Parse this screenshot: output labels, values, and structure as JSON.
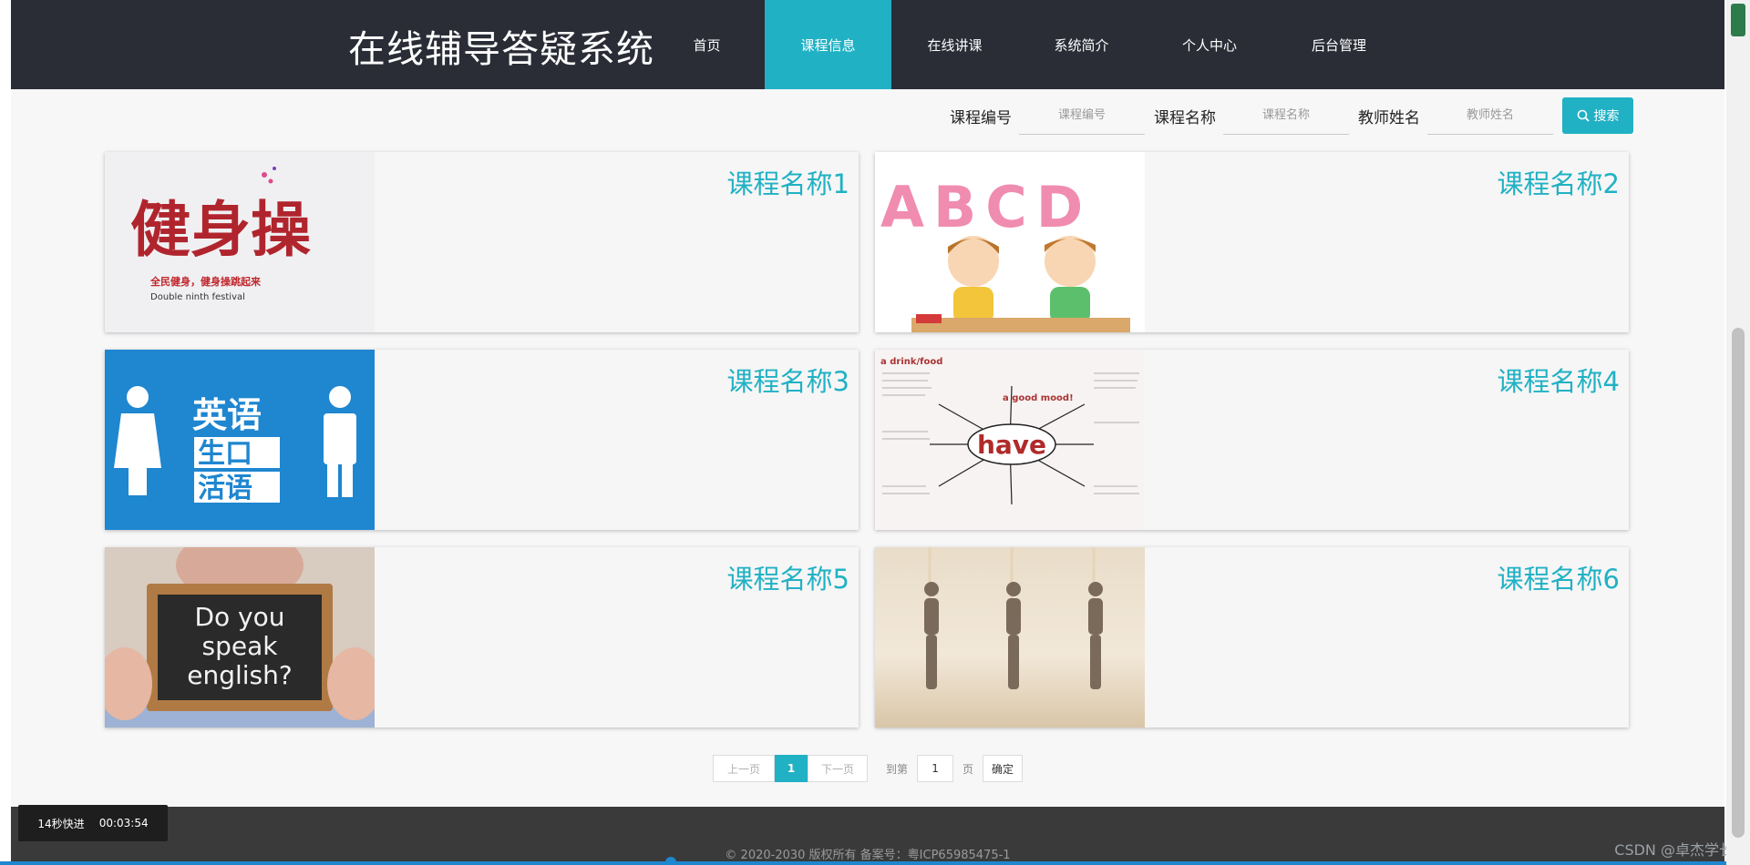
{
  "header": {
    "site_title": "在线辅导答疑系统",
    "nav": [
      {
        "label": "首页",
        "width": 127
      },
      {
        "label": "课程信息",
        "width": 139,
        "active": true
      },
      {
        "label": "在线讲课",
        "width": 139
      },
      {
        "label": "系统简介",
        "width": 139
      },
      {
        "label": "个人中心",
        "width": 142
      },
      {
        "label": "后台管理",
        "width": 142
      }
    ]
  },
  "search": {
    "course_code_label": "课程编号",
    "course_code_placeholder": "课程编号",
    "course_name_label": "课程名称",
    "course_name_placeholder": "课程名称",
    "teacher_label": "教师姓名",
    "teacher_placeholder": "教师姓名",
    "button_label": "搜索"
  },
  "courses": [
    {
      "title": "课程名称1",
      "thumb_text": "健身操",
      "thumb_sub": "全民健身，健身操跳起来",
      "thumb_sub2": "Double ninth festival"
    },
    {
      "title": "课程名称2",
      "thumb_text": "ABCD"
    },
    {
      "title": "课程名称3",
      "thumb_text": "英语",
      "thumb_sub": "生口",
      "thumb_sub2": "活语"
    },
    {
      "title": "课程名称4",
      "thumb_text": "have",
      "thumb_sub": "a drink/food",
      "thumb_sub2": "a good mood!"
    },
    {
      "title": "课程名称5",
      "thumb_text": "Do you",
      "thumb_sub": "speak",
      "thumb_sub2": "english?"
    },
    {
      "title": "课程名称6"
    }
  ],
  "pagination": {
    "prev_label": "上一页",
    "current_page": "1",
    "next_label": "下一页",
    "goto_label": "到第",
    "goto_value": "1",
    "page_unit": "页",
    "confirm_label": "确定"
  },
  "footer": {
    "copyright": "© 2020-2030 版权所有 备案号：粤ICP65985475-1"
  },
  "overlay": {
    "fast_forward": "14秒快进",
    "timestamp": "00:03:54",
    "watermark": "CSDN @卓杰学长"
  },
  "colors": {
    "accent": "#21b1c4",
    "header_bg": "#2a2d36",
    "footer_bg": "#3a3a3a"
  }
}
